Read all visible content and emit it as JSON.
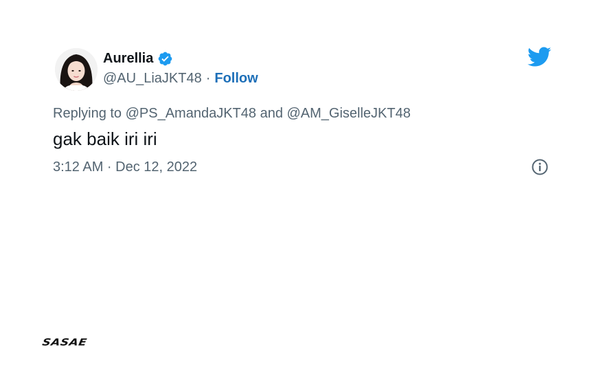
{
  "author": {
    "name": "Aurellia",
    "handle": "@AU_LiaJKT48",
    "separator": "·",
    "follow_label": "Follow",
    "verified_icon": "verified-badge-icon",
    "avatar_icon": "profile-photo"
  },
  "reply": {
    "text": "Replying to @PS_AmandaJKT48 and @AM_GiselleJKT48"
  },
  "tweet": {
    "text": "gak baik iri iri",
    "timestamp": "3:12 AM · Dec 12, 2022"
  },
  "icons": {
    "platform": "twitter-bird-icon",
    "info": "info-icon"
  },
  "brand": {
    "text": "SASAE"
  },
  "colors": {
    "twitter_blue": "#1d9bf0",
    "follow_blue": "#1d6fb8",
    "text_primary": "#0f1419",
    "text_secondary": "#536471"
  }
}
